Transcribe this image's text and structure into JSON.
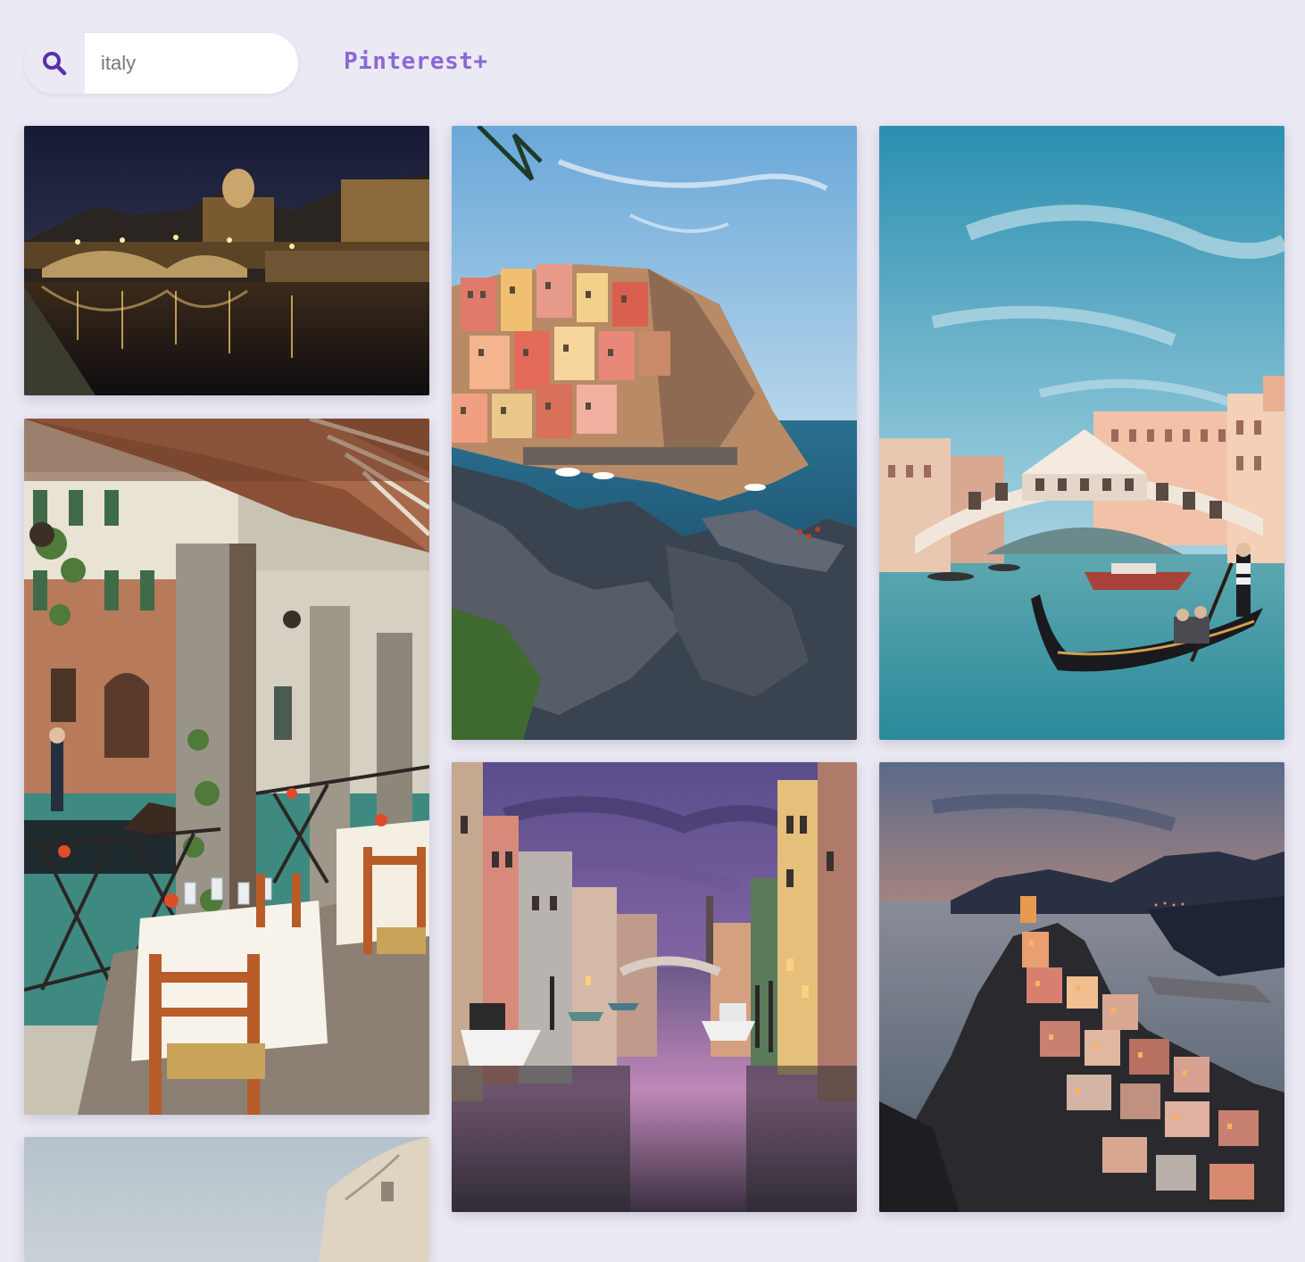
{
  "search": {
    "icon": "search-icon",
    "placeholder": "italy",
    "value": "italy"
  },
  "brand": {
    "name": "Pinterest+",
    "color": "#8b68d6"
  },
  "accent_color": "#5b2fa8",
  "pins": [
    {
      "scene": "rome-bridge-night"
    },
    {
      "scene": "venice-restaurant-canal"
    },
    {
      "scene": "roman-arena"
    },
    {
      "scene": "manarola-cliffside"
    },
    {
      "scene": "venice-canal-sunset"
    },
    {
      "scene": "rialto-bridge-gondola"
    },
    {
      "scene": "vernazza-dusk"
    }
  ]
}
